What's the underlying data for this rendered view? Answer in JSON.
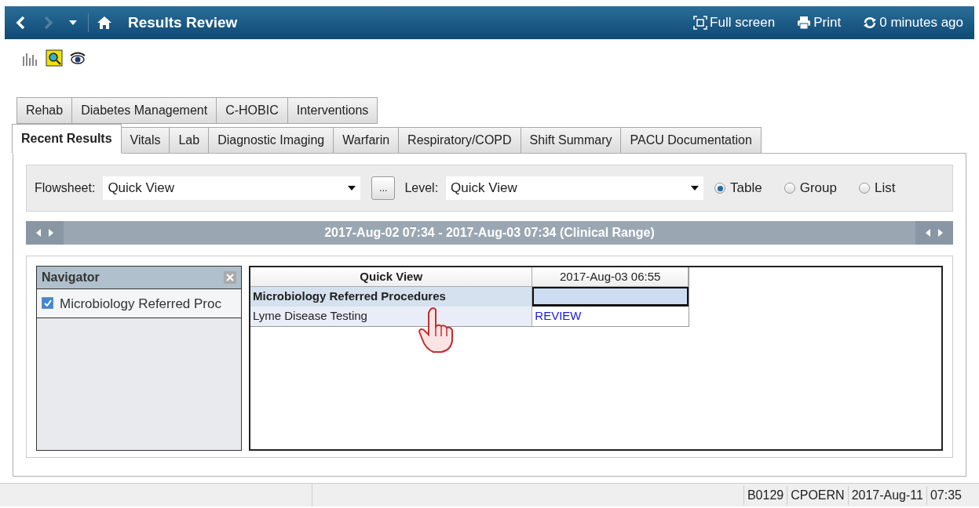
{
  "title_bar": {
    "title": "Results Review",
    "actions": [
      {
        "kind": "fullscreen",
        "label": "Full screen"
      },
      {
        "kind": "print",
        "label": "Print"
      },
      {
        "kind": "refresh",
        "label": "0 minutes ago"
      }
    ]
  },
  "tab_rows": [
    [
      {
        "label": "Rehab",
        "selected": false
      },
      {
        "label": "Diabetes Management",
        "selected": false
      },
      {
        "label": "C-HOBIC",
        "selected": false
      },
      {
        "label": "Interventions",
        "selected": false
      }
    ],
    [
      {
        "label": "Recent Results",
        "selected": true
      },
      {
        "label": "Vitals",
        "selected": false
      },
      {
        "label": "Lab",
        "selected": false
      },
      {
        "label": "Diagnostic Imaging",
        "selected": false
      },
      {
        "label": "Warfarin",
        "selected": false
      },
      {
        "label": "Respiratory/COPD",
        "selected": false
      },
      {
        "label": "Shift Summary",
        "selected": false
      },
      {
        "label": "PACU Documentation",
        "selected": false
      }
    ]
  ],
  "filter": {
    "flowsheet_label": "Flowsheet:",
    "flowsheet_value": "Quick View",
    "more_button": "...",
    "level_label": "Level:",
    "level_value": "Quick View",
    "view_options": [
      {
        "label": "Table",
        "selected": true
      },
      {
        "label": "Group",
        "selected": false
      },
      {
        "label": "List",
        "selected": false
      }
    ]
  },
  "range_bar": {
    "text": "2017-Aug-02 07:34 - 2017-Aug-03 07:34 (Clinical Range)"
  },
  "navigator": {
    "title": "Navigator",
    "items": [
      {
        "label": "Microbiology Referred Proc",
        "checked": true
      }
    ]
  },
  "grid": {
    "columns": [
      "Quick View",
      "2017-Aug-03 06:55"
    ],
    "rows": [
      {
        "kind": "section",
        "label": "Microbiology Referred Procedures",
        "selected": true
      },
      {
        "kind": "result",
        "label": "Lyme Disease Testing",
        "value": "REVIEW",
        "selected": false
      }
    ]
  },
  "status_bar": [
    "B0129",
    "CPOERN",
    "2017-Aug-11",
    "07:35"
  ]
}
